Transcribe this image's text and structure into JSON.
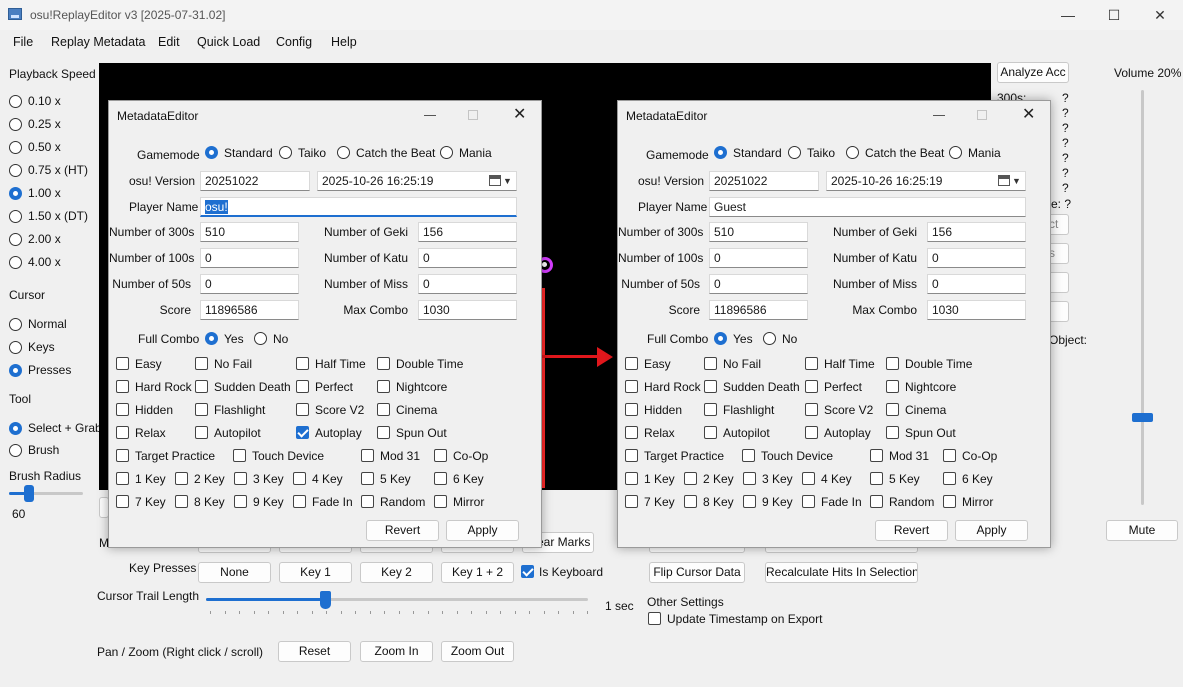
{
  "window": {
    "title": "osu!ReplayEditor v3 [2025-07-31.02]"
  },
  "menu": [
    "File",
    "Replay Metadata",
    "Edit",
    "Quick Load",
    "Config",
    "Help"
  ],
  "left_panel": {
    "playback_speed_label": "Playback Speed",
    "speeds": [
      "0.10 x",
      "0.25 x",
      "0.50 x",
      "0.75 x (HT)",
      "1.00 x",
      "1.50 x (DT)",
      "2.00 x",
      "4.00 x"
    ],
    "speed_selected": "1.00 x",
    "cursor_label": "Cursor",
    "cursor_options": [
      "Normal",
      "Keys",
      "Presses"
    ],
    "cursor_selected": "Presses",
    "tool_label": "Tool",
    "tool_options": [
      "Select + Grab",
      "Brush"
    ],
    "tool_selected": "Select + Grab",
    "brush_radius_label": "Brush Radius",
    "brush_radius_value": "60"
  },
  "right_panel": {
    "analyze_button": "Analyze Acc",
    "stat_label_300": "300s:",
    "stat_values": [
      "?",
      "?",
      "?",
      "?",
      "?",
      "?",
      "?"
    ],
    "partial_label": "e: ?",
    "partial_button_labels": [
      "ct",
      "s",
      "",
      ""
    ],
    "object_label": "Object:",
    "volume_label": "Volume 20%",
    "volume_level": 0.2,
    "mute_button": "Mute"
  },
  "bottom": {
    "marks_label": "M",
    "clear_marks_button": "ear Marks",
    "key_presses_label": "Key Presses",
    "key_buttons": [
      "None",
      "Key 1",
      "Key 2",
      "Key 1 + 2"
    ],
    "is_keyboard_label": "Is Keyboard",
    "is_keyboard_checked": true,
    "flip_cursor_button": "Flip Cursor Data",
    "recalc_button": "Recalculate Hits In Selection",
    "cursor_trail_label": "Cursor Trail Length",
    "cursor_trail_value": "1 sec",
    "other_settings_label": "Other Settings",
    "update_timestamp_label": "Update Timestamp on Export",
    "update_timestamp_checked": false,
    "pan_zoom_label": "Pan / Zoom (Right click / scroll)",
    "reset_button": "Reset",
    "zoom_in_button": "Zoom In",
    "zoom_out_button": "Zoom Out"
  },
  "dialog_left": {
    "title": "MetadataEditor",
    "gamemode_label": "Gamemode",
    "gamemodes": [
      "Standard",
      "Taiko",
      "Catch the Beat",
      "Mania"
    ],
    "gamemode_selected": "Standard",
    "version_label": "osu! Version",
    "version_value": "20251022",
    "datetime_value": "2025-10-26 16:25:19",
    "player_label": "Player Name",
    "player_value": "osu!",
    "n300_label": "Number of 300s",
    "n300_value": "510",
    "geki_label": "Number of Geki",
    "geki_value": "156",
    "n100_label": "Number of 100s",
    "n100_value": "0",
    "katu_label": "Number of Katu",
    "katu_value": "0",
    "n50_label": "Number of 50s",
    "n50_value": "0",
    "miss_label": "Number of Miss",
    "miss_value": "0",
    "score_label": "Score",
    "score_value": "11896586",
    "combo_label": "Max Combo",
    "combo_value": "1030",
    "fullcombo_label": "Full Combo",
    "fullcombo_options": [
      "Yes",
      "No"
    ],
    "fullcombo_selected": "Yes",
    "mods": [
      "Easy",
      "No Fail",
      "Half Time",
      "Double Time",
      "Hard Rock",
      "Sudden Death",
      "Perfect",
      "Nightcore",
      "Hidden",
      "Flashlight",
      "Score V2",
      "Cinema",
      "Relax",
      "Autopilot",
      "Autoplay",
      "Spun Out",
      "Target Practice",
      "Touch Device",
      "Mod 31",
      "Co-Op",
      "1 Key",
      "2 Key",
      "3 Key",
      "4 Key",
      "5 Key",
      "6 Key",
      "7 Key",
      "8 Key",
      "9 Key",
      "Fade In",
      "Random",
      "Mirror"
    ],
    "mods_checked": [
      "Autoplay"
    ],
    "revert_button": "Revert",
    "apply_button": "Apply"
  },
  "dialog_right": {
    "title": "MetadataEditor",
    "gamemode_label": "Gamemode",
    "gamemodes": [
      "Standard",
      "Taiko",
      "Catch the Beat",
      "Mania"
    ],
    "gamemode_selected": "Standard",
    "version_label": "osu! Version",
    "version_value": "20251022",
    "datetime_value": "2025-10-26 16:25:19",
    "player_label": "Player Name",
    "player_value": "Guest",
    "n300_label": "Number of 300s",
    "n300_value": "510",
    "geki_label": "Number of Geki",
    "geki_value": "156",
    "n100_label": "Number of 100s",
    "n100_value": "0",
    "katu_label": "Number of Katu",
    "katu_value": "0",
    "n50_label": "Number of 50s",
    "n50_value": "0",
    "miss_label": "Number of Miss",
    "miss_value": "0",
    "score_label": "Score",
    "score_value": "11896586",
    "combo_label": "Max Combo",
    "combo_value": "1030",
    "fullcombo_label": "Full Combo",
    "fullcombo_options": [
      "Yes",
      "No"
    ],
    "fullcombo_selected": "Yes",
    "mods": [
      "Easy",
      "No Fail",
      "Half Time",
      "Double Time",
      "Hard Rock",
      "Sudden Death",
      "Perfect",
      "Nightcore",
      "Hidden",
      "Flashlight",
      "Score V2",
      "Cinema",
      "Relax",
      "Autopilot",
      "Autoplay",
      "Spun Out",
      "Target Practice",
      "Touch Device",
      "Mod 31",
      "Co-Op",
      "1 Key",
      "2 Key",
      "3 Key",
      "4 Key",
      "5 Key",
      "6 Key",
      "7 Key",
      "8 Key",
      "9 Key",
      "Fade In",
      "Random",
      "Mirror"
    ],
    "mods_checked": [],
    "revert_button": "Revert",
    "apply_button": "Apply"
  },
  "colors": {
    "accent": "#1e6fd0",
    "arrow": "#e0171c",
    "video_bg": "#000000",
    "playfield_magenta": "#d43cff",
    "playfield_red": "#ff2a2a"
  },
  "icons": [
    "app-icon",
    "minimize-icon",
    "maximize-icon",
    "close-icon",
    "calendar-icon",
    "dropdown-caret-icon",
    "arrow-right-icon"
  ]
}
